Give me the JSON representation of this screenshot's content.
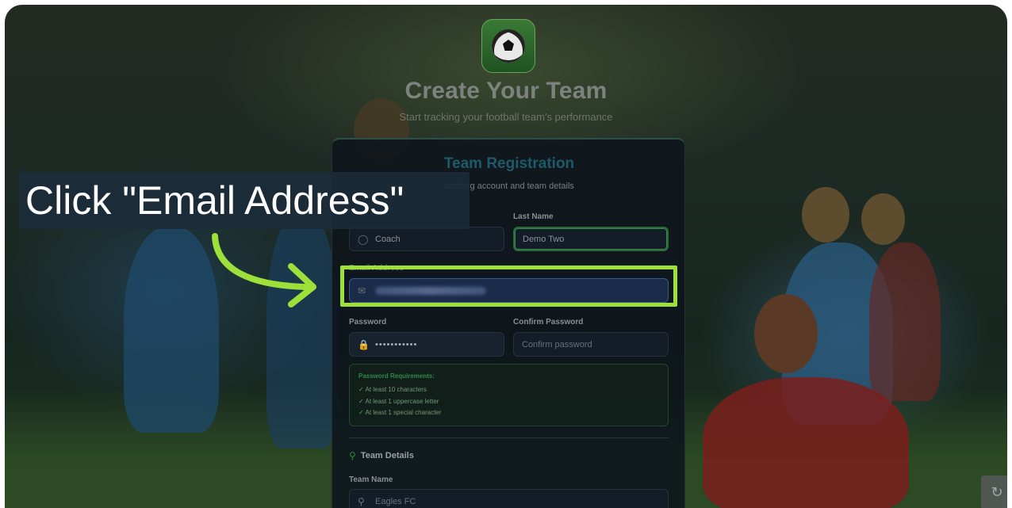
{
  "header": {
    "title": "Create Your Team",
    "subtitle": "Start tracking your football team's performance"
  },
  "card": {
    "title": "Team Registration",
    "subtitle": "oaching account and team details"
  },
  "form": {
    "last_name_label": "Last Name",
    "first_name_value": "Coach",
    "last_name_value": "Demo Two",
    "email_label": "Email Address",
    "password_label": "Password",
    "password_value": "•••••••••••",
    "confirm_label": "Confirm Password",
    "confirm_placeholder": "Confirm password"
  },
  "requirements": {
    "title": "Password Requirements:",
    "items": [
      "✓  At least 10 characters",
      "✓  At least 1 uppercase letter",
      "✓  At least 1 special character"
    ]
  },
  "team": {
    "section_title": "Team Details",
    "name_label": "Team Name",
    "name_placeholder": "Eagles FC"
  },
  "annotation": {
    "callout_text": "Click \"Email Address\"",
    "highlight_color": "#9ee03a"
  },
  "icons": {
    "user": "user-icon",
    "mail": "mail-icon",
    "lock": "lock-icon",
    "trophy": "trophy-icon",
    "logo": "soccer-ball-icon"
  }
}
